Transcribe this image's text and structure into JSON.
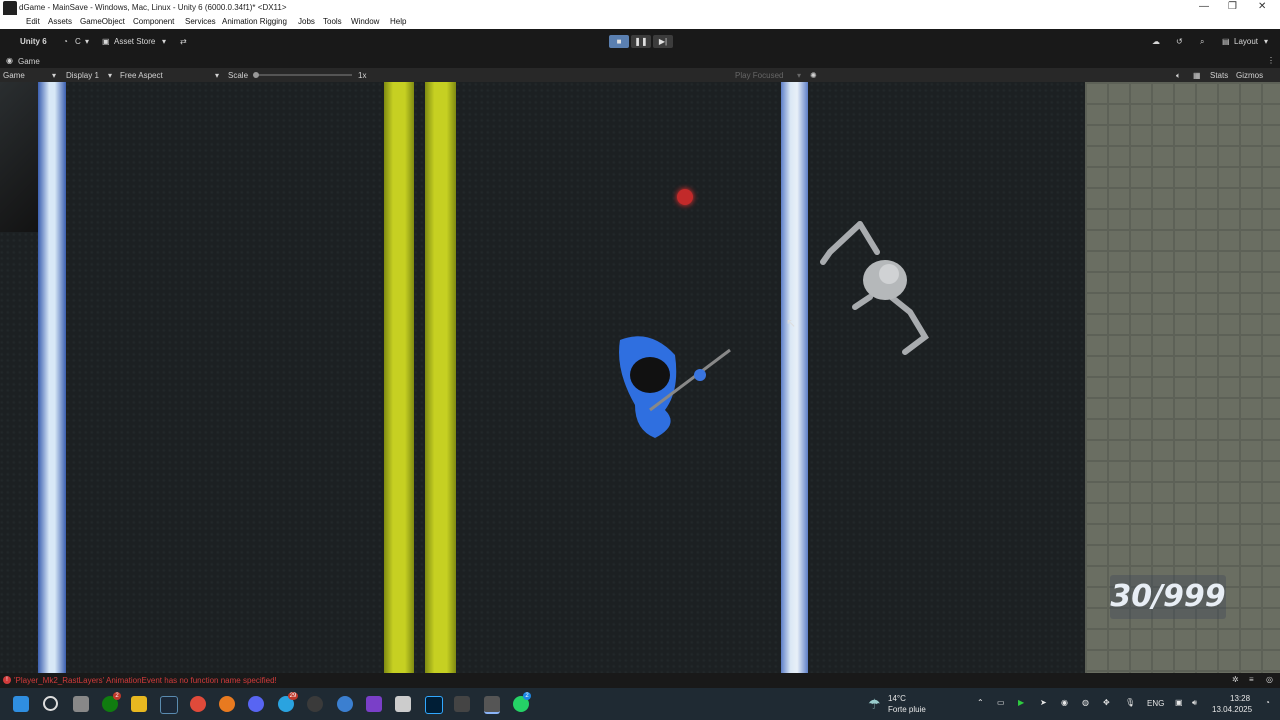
{
  "window": {
    "title": "dGame - MainSave - Windows, Mac, Linux - Unity 6 (6000.0.34f1)* <DX11>"
  },
  "menu": [
    "Edit",
    "Assets",
    "GameObject",
    "Component",
    "Services",
    "Animation Rigging",
    "Jobs",
    "Tools",
    "Window",
    "Help"
  ],
  "toolbar": {
    "unity_label": "Unity 6",
    "account_label": "C",
    "asset_store_label": "Asset Store",
    "layout_label": "Layout"
  },
  "game_tab": {
    "label": "Game"
  },
  "game_toolbar": {
    "mode": "Game",
    "display": "Display 1",
    "aspect": "Free Aspect",
    "scale_label": "Scale",
    "scale_value": "1x",
    "play_focus": "Play Focused",
    "stats": "Stats",
    "gizmos": "Gizmos"
  },
  "hud": {
    "counter": "30/999"
  },
  "console": {
    "message": "'Player_Mk2_RastLayers' AnimationEvent has no function name specified!"
  },
  "taskbar": {
    "weather_temp": "14°C",
    "weather_desc": "Forte pluie",
    "language": "ENG",
    "time": "13:28",
    "date": "13.04.2025",
    "badges": [
      "2",
      "29",
      "2"
    ]
  },
  "colors": {
    "road": "#1c2022",
    "lane_yellow": "#b5c21a",
    "lane_white": "#c8dcf0",
    "blue_player": "#2f6fe0",
    "error_red": "#d23b3b"
  }
}
